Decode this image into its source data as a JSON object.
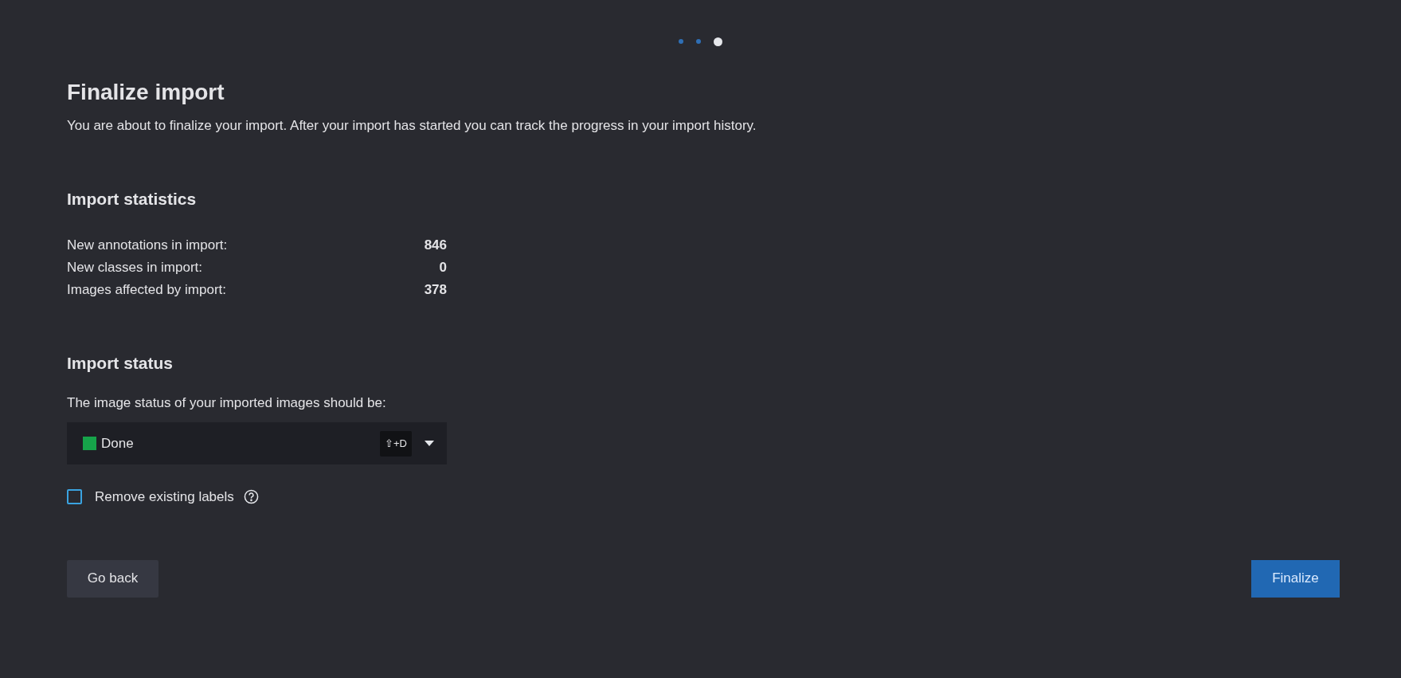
{
  "steps": [
    {
      "selected": false
    },
    {
      "selected": false
    },
    {
      "selected": true
    }
  ],
  "title": "Finalize import",
  "description": "You are about to finalize your import. After your import has started you can track the progress in your import history.",
  "statistics": {
    "heading": "Import statistics",
    "rows": [
      {
        "label": "New annotations in import:",
        "value": "846"
      },
      {
        "label": "New classes in import:",
        "value": "0"
      },
      {
        "label": "Images affected by import:",
        "value": "378"
      }
    ]
  },
  "status": {
    "heading": "Import status",
    "prompt": "The image status of your imported images should be:",
    "dropdown": {
      "value": "Done",
      "color": "#16a34a",
      "shortcut": "⇧+D"
    },
    "checkbox": {
      "label": "Remove existing labels",
      "checked": false
    }
  },
  "buttons": {
    "back": "Go back",
    "finalize": "Finalize"
  }
}
